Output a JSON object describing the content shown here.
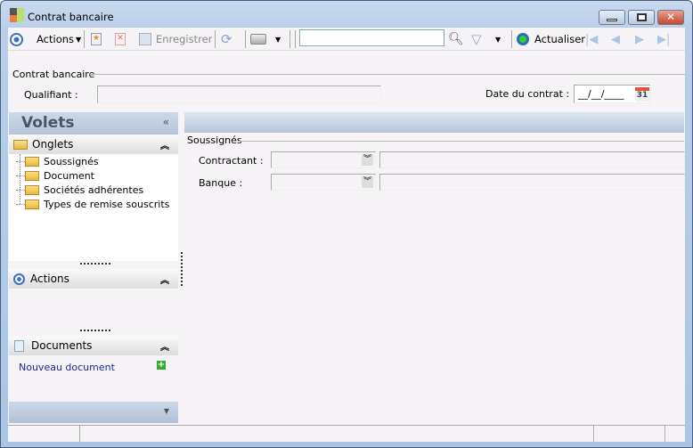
{
  "window": {
    "title": "Contrat bancaire"
  },
  "toolbar": {
    "actions": "Actions",
    "save": "Enregistrer",
    "search_value": "",
    "refresh": "Actualiser"
  },
  "header": {
    "group": "Contrat bancaire",
    "qualifiant_label": "Qualifiant :",
    "qualifiant_value": "",
    "date_label": "Date du contrat :",
    "date_value": "__/__/____",
    "calendar_day": "31"
  },
  "left": {
    "title": "Volets",
    "onglets": "Onglets",
    "tabs": [
      "Soussignés",
      "Document",
      "Sociétés adhérentes",
      "Types de remise souscrits"
    ],
    "actions": "Actions",
    "documents": "Documents",
    "new_document": "Nouveau document"
  },
  "main": {
    "group": "Soussignés",
    "contractant_label": "Contractant :",
    "banque_label": "Banque :"
  }
}
